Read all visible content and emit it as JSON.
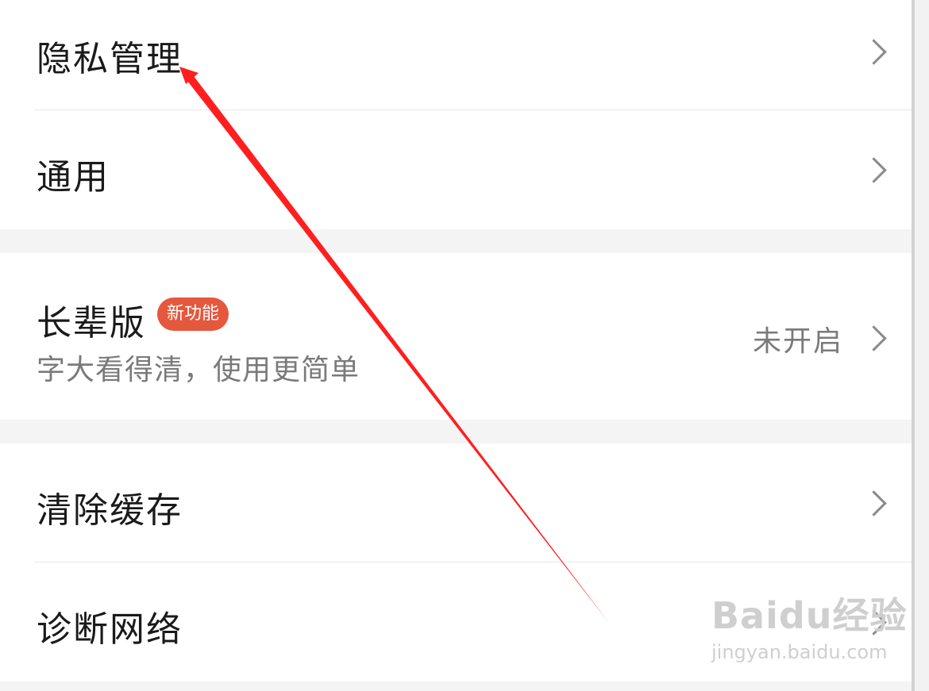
{
  "settings": {
    "items": [
      {
        "label": "隐私管理"
      },
      {
        "label": "通用"
      },
      {
        "label": "长辈版",
        "badge": "新功能",
        "subtitle": "字大看得清，使用更简单",
        "status": "未开启"
      },
      {
        "label": "清除缓存"
      },
      {
        "label": "诊断网络"
      }
    ]
  },
  "colors": {
    "badge": "#e4583e",
    "annotation_arrow": "#ff1f1f",
    "section_gap": "#f4f4f4"
  },
  "icons": {
    "row_chevron": "chevron-right-icon"
  },
  "watermark": {
    "brand": "Baidu经验",
    "url": "jingyan.baidu.com"
  }
}
